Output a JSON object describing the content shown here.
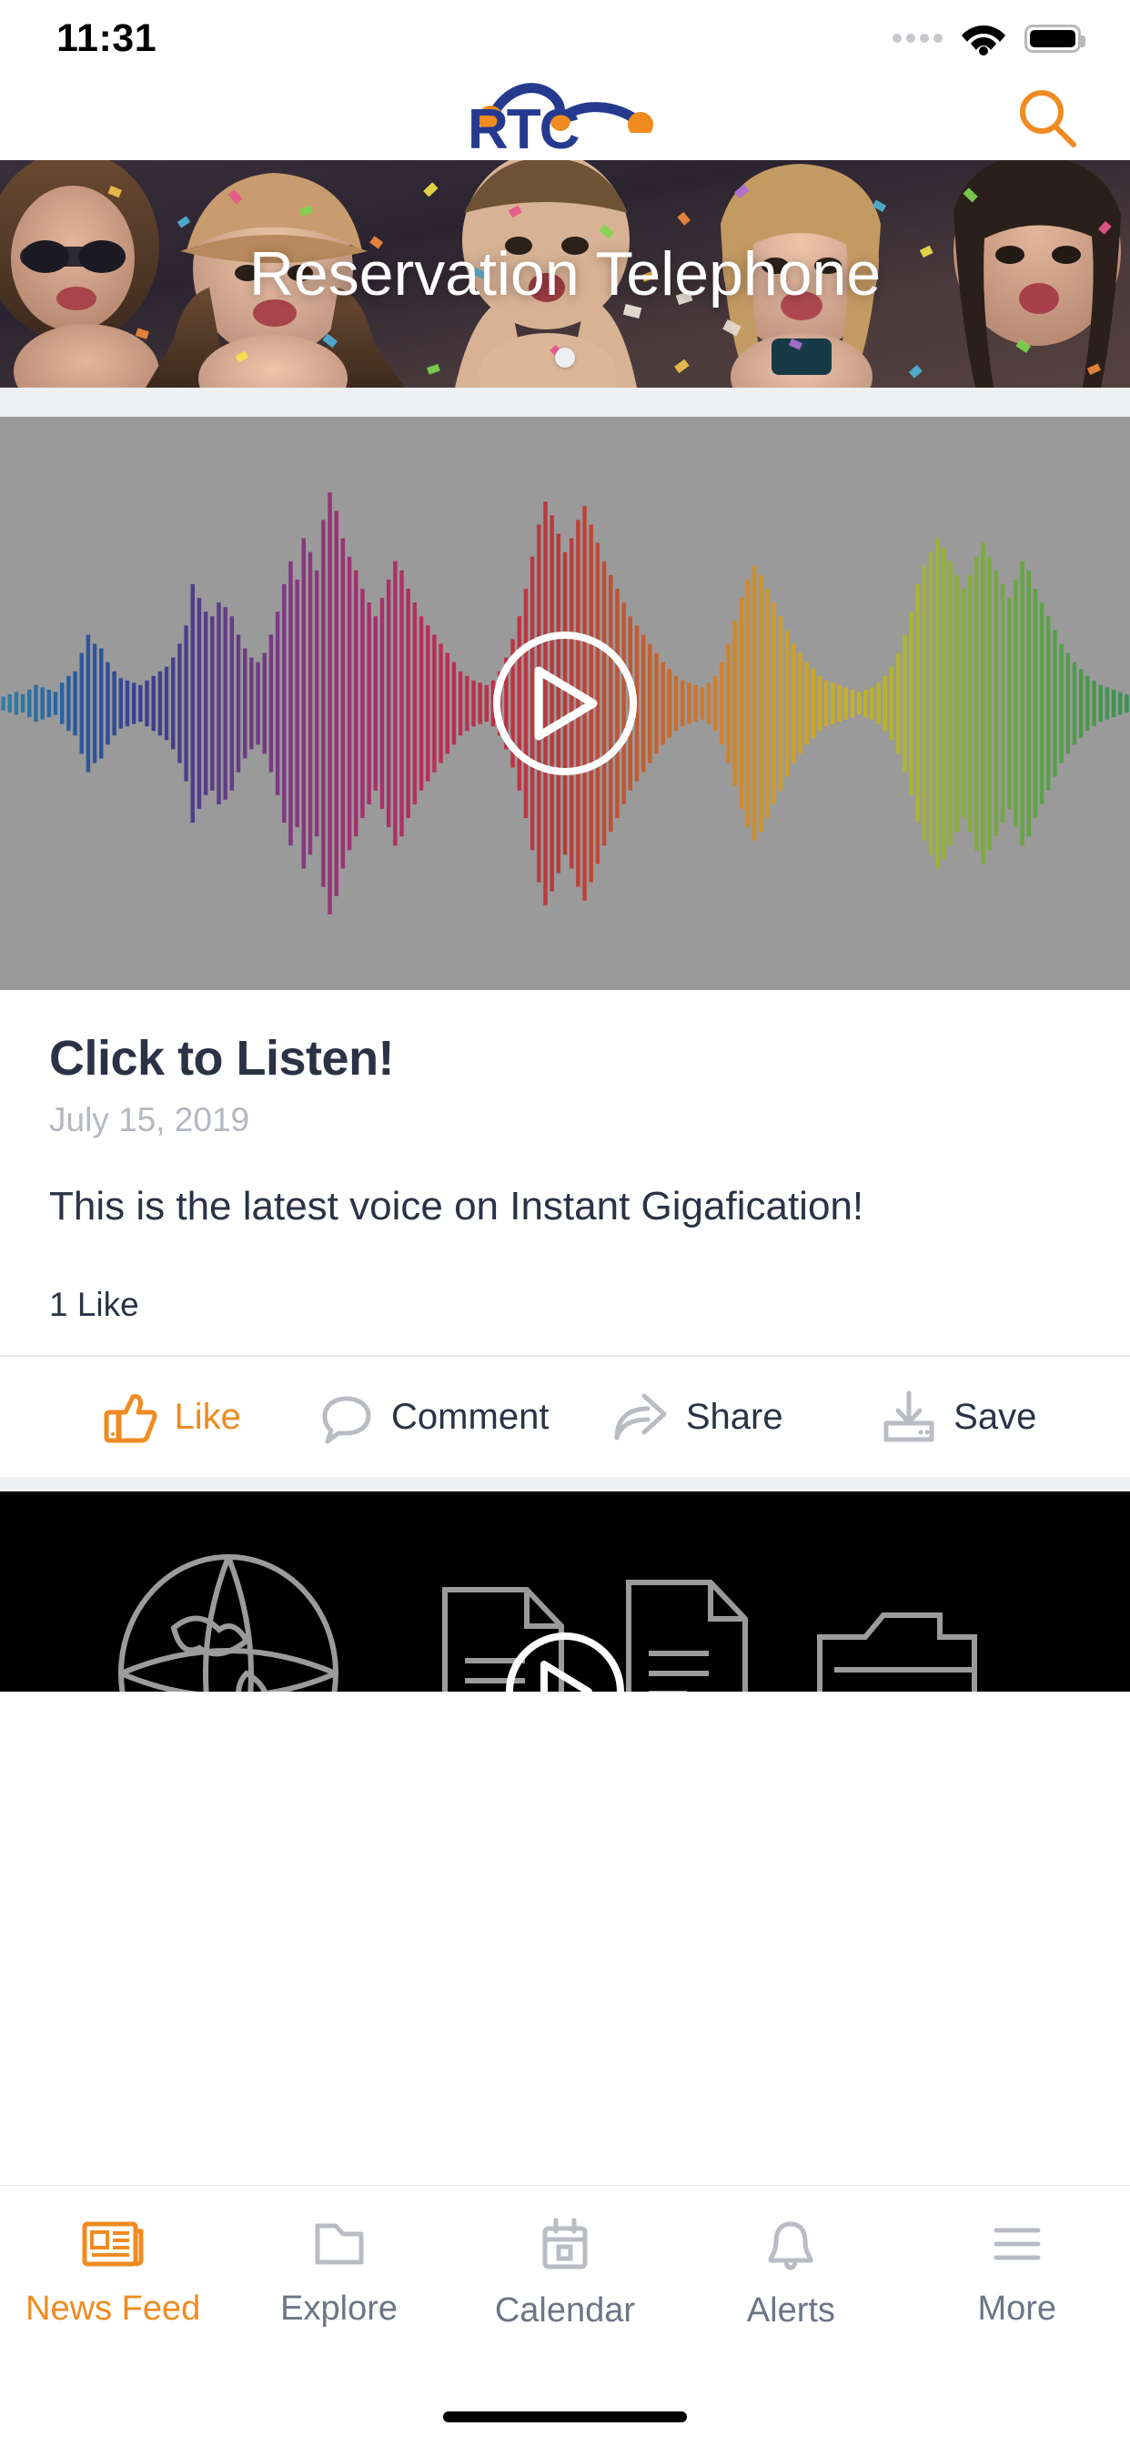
{
  "status_bar": {
    "time": "11:31",
    "signal_icon": "signal-dots-icon",
    "wifi_icon": "wifi-icon",
    "battery_icon": "battery-full-icon"
  },
  "header": {
    "logo_text": "RTC",
    "logo_name": "rtc-logo",
    "logo_blue": "#253a8e",
    "logo_orange": "#f08c1f",
    "search_icon": "search-icon",
    "search_color": "#ef8b22"
  },
  "hero": {
    "title": "Reservation Telephone",
    "image_alt": "people-blowing-confetti-photo",
    "pagination_dots": 1,
    "active_dot_index": 0
  },
  "post": {
    "media_type": "audio",
    "play_icon": "play-circle-icon",
    "waveform_panel_color": "#9a9a9a",
    "title": "Click to Listen!",
    "date": "July 15, 2019",
    "text": "This is the latest voice on Instant Gigafication!",
    "like_count": "1 Like",
    "actions": [
      {
        "label": "Like",
        "icon": "thumbs-up-icon",
        "active": true,
        "color": "#ef8b22"
      },
      {
        "label": "Comment",
        "icon": "comment-bubble-icon",
        "active": false,
        "color": "#2b3246"
      },
      {
        "label": "Share",
        "icon": "share-arrow-icon",
        "active": false,
        "color": "#2b3246"
      },
      {
        "label": "Save",
        "icon": "save-download-icon",
        "active": false,
        "color": "#2b3246"
      }
    ]
  },
  "second_post": {
    "media_type": "video",
    "background": "#000000",
    "play_icon": "play-circle-icon",
    "thumbnail_icons": [
      "globe-icon",
      "document-icon",
      "document-icon",
      "folder-icon"
    ]
  },
  "tab_bar": {
    "active_color": "#ef8b22",
    "inactive_color": "#6d7486",
    "items": [
      {
        "label": "News Feed",
        "icon": "newspaper-icon",
        "active": true
      },
      {
        "label": "Explore",
        "icon": "folder-icon",
        "active": false
      },
      {
        "label": "Calendar",
        "icon": "calendar-icon",
        "active": false
      },
      {
        "label": "Alerts",
        "icon": "bell-icon",
        "active": false
      },
      {
        "label": "More",
        "icon": "hamburger-menu-icon",
        "active": false
      }
    ]
  },
  "chart_data": {
    "type": "bar",
    "title": "Audio waveform",
    "description": "Symmetric audio amplitude waveform, rainbow gradient left-to-right",
    "values": [
      3,
      4,
      5,
      4,
      6,
      8,
      7,
      6,
      5,
      9,
      12,
      14,
      22,
      30,
      26,
      24,
      18,
      14,
      11,
      10,
      9,
      8,
      10,
      12,
      14,
      16,
      20,
      26,
      34,
      52,
      46,
      40,
      38,
      44,
      42,
      38,
      30,
      24,
      20,
      18,
      22,
      30,
      40,
      52,
      62,
      54,
      72,
      66,
      58,
      80,
      92,
      84,
      72,
      64,
      58,
      50,
      44,
      38,
      46,
      54,
      62,
      58,
      50,
      44,
      38,
      34,
      30,
      26,
      22,
      18,
      14,
      12,
      10,
      9,
      8,
      10,
      14,
      20,
      28,
      38,
      50,
      64,
      78,
      88,
      82,
      74,
      66,
      72,
      80,
      86,
      78,
      70,
      62,
      56,
      50,
      44,
      38,
      34,
      30,
      26,
      22,
      18,
      15,
      12,
      10,
      9,
      8,
      7,
      9,
      12,
      18,
      26,
      36,
      46,
      54,
      60,
      56,
      50,
      44,
      38,
      32,
      26,
      22,
      18,
      15,
      12,
      10,
      9,
      8,
      7,
      6,
      5,
      6,
      7,
      9,
      12,
      16,
      22,
      30,
      40,
      52,
      60,
      66,
      72,
      68,
      62,
      56,
      50,
      56,
      64,
      70,
      64,
      58,
      52,
      46,
      54,
      62,
      58,
      50,
      44,
      38,
      32,
      26,
      22,
      18,
      15,
      12,
      10,
      8,
      7,
      6,
      5,
      4
    ],
    "gradient_stops": [
      "#2f7fa8",
      "#2a5ba0",
      "#3a3f92",
      "#5b3d88",
      "#7d3a80",
      "#a03270",
      "#b82e5c",
      "#bd3146",
      "#b93c3a",
      "#c25a33",
      "#cc7a2c",
      "#d09a28",
      "#c9b026",
      "#a8b533",
      "#7aab3e",
      "#55a04a",
      "#3d8f52"
    ],
    "ylim": [
      0,
      100
    ]
  }
}
